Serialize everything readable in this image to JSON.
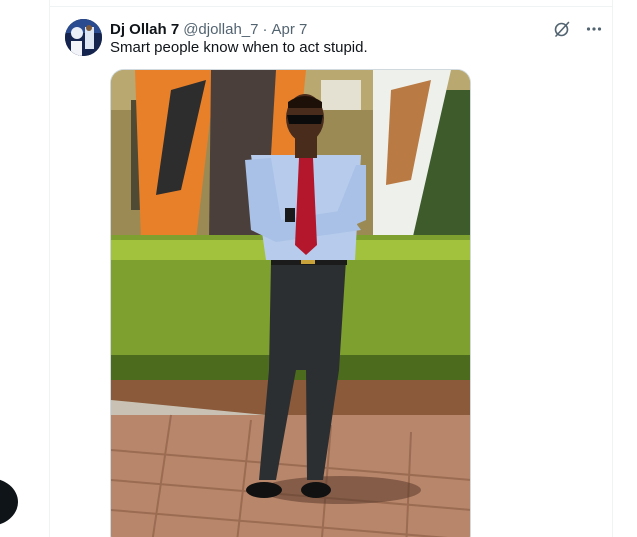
{
  "post": {
    "author_name": "Dj Ollah 7",
    "handle": "@djollah_7",
    "separator": "·",
    "date": "Apr 7",
    "text": "Smart people know when to act stupid."
  },
  "icons": {
    "grok": "grok-icon",
    "more": "more-icon",
    "avatar": "avatar",
    "floating": "compose-icon"
  },
  "colors": {
    "text_primary": "#0f1419",
    "text_secondary": "#536471",
    "border": "#eff3f4"
  }
}
